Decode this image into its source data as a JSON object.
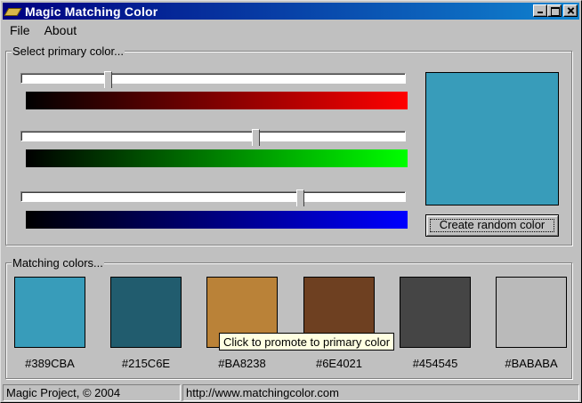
{
  "window": {
    "title": "Magic Matching Color"
  },
  "menu": {
    "items": [
      {
        "label": "File"
      },
      {
        "label": "About"
      }
    ]
  },
  "primary": {
    "group_label": "Select primary color...",
    "sliders": [
      {
        "channel": "red",
        "value": 56,
        "max": 255
      },
      {
        "channel": "green",
        "value": 156,
        "max": 255
      },
      {
        "channel": "blue",
        "value": 186,
        "max": 255
      }
    ],
    "color": "#389CBA",
    "random_button_label": "Create random color"
  },
  "matching": {
    "group_label": "Matching colors...",
    "colors": [
      {
        "hex": "#389CBA"
      },
      {
        "hex": "#215C6E"
      },
      {
        "hex": "#BA8238"
      },
      {
        "hex": "#6E4021"
      },
      {
        "hex": "#454545"
      },
      {
        "hex": "#BABABA"
      }
    ],
    "tooltip": "Click to promote to primary color"
  },
  "status": {
    "left": "Magic Project, © 2004",
    "right": "http://www.matchingcolor.com"
  }
}
